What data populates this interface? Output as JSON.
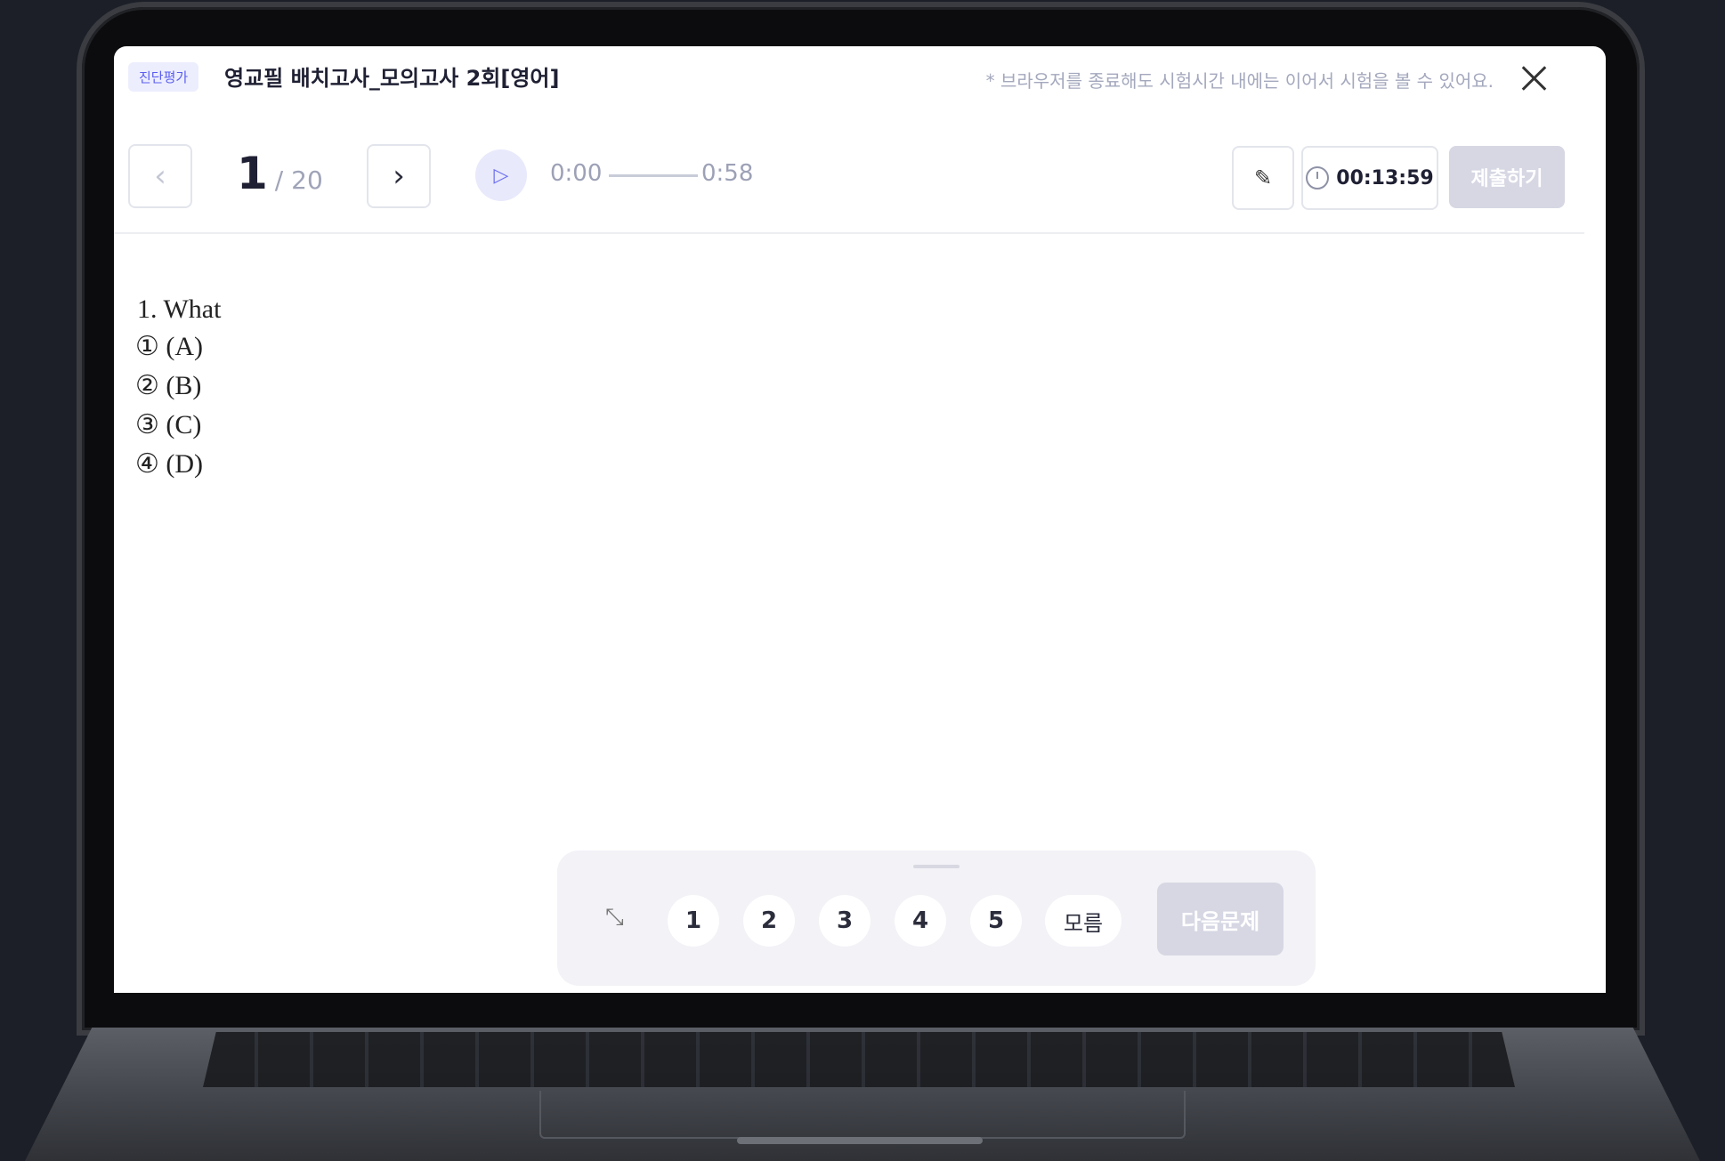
{
  "header": {
    "badge": "진단평가",
    "title": "영교필 배치고사_모의고사 2회[영어]",
    "notice": "* 브라우저를 종료해도 시험시간 내에는 이어서 시험을 볼 수 있어요."
  },
  "toolbar": {
    "current_question": "1",
    "total_questions": "/ 20",
    "audio_current": "0:00",
    "audio_end": "0:58",
    "timer": "00:13:59",
    "submit_label": "제출하기"
  },
  "question": {
    "text": "1. What",
    "options": [
      "① (A)",
      "② (B)",
      "③ (C)",
      "④ (D)"
    ]
  },
  "answer_bar": {
    "choices": [
      "1",
      "2",
      "3",
      "4",
      "5"
    ],
    "unknown_label": "모름",
    "next_label": "다음문제"
  },
  "colors": {
    "accent": "#6d70f0",
    "disabled": "#d6d7e3"
  }
}
